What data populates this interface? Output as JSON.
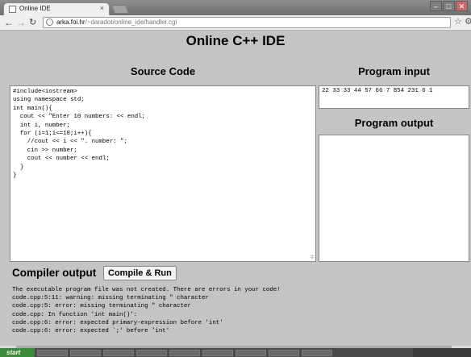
{
  "browser": {
    "tab_title": "Online IDE",
    "tab_close": "×",
    "url_host": "arka.foi.hr",
    "url_path": "/~daradot/online_ide/handler.cgi"
  },
  "page": {
    "title": "Online C++ IDE",
    "source_code_heading": "Source Code",
    "source_code": "#include<iostream>\nusing namespace std;\nint main(){\n  cout << \"Enter 10 numbers: << endl;\n  int i, number;\n  for (i=1;i<=10;i++){\n    //cout << i << \". number: \";\n    cin >> number;\n    cout << number << endl;\n  }\n}",
    "program_input_heading": "Program input",
    "program_input": "22 33 33 44 57 66 7 854 231 6 1",
    "program_output_heading": "Program output",
    "program_output": "",
    "compiler_output_heading": "Compiler output",
    "compile_run_label": "Compile & Run",
    "compiler_output": "The executable program file was not created. There are errors in your code!\ncode.cpp:5:11: warning: missing terminating \" character\ncode.cpp:5: error: missing terminating \" character\ncode.cpp: In function 'int main()':\ncode.cpp:6: error: expected primary-expression before 'int'\ncode.cpp:6: error: expected `;' before 'int'"
  },
  "taskbar": {
    "start_label": "start"
  }
}
